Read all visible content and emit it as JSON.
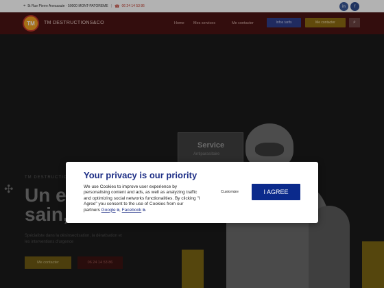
{
  "topbar": {
    "location_icon": "map-pin-icon",
    "address": "5t Rue Pierre Anesasute · 50000 MONT-PATOREME",
    "phone_icon": "phone-icon",
    "phone": "06 24 14 53 86",
    "social": [
      "in",
      "f"
    ]
  },
  "header": {
    "logo": "TM",
    "brand": "TM DESTRUCTIONS&CO",
    "nav": [
      "Home",
      "Mes services",
      "Me contacter"
    ],
    "btn_info": "Infos tarifs",
    "btn_contact": "Me contacter",
    "search_icon": "search-icon"
  },
  "hero": {
    "service_title": "Service",
    "service_sub": "Antiparasitaire",
    "kicker": "TM DESTRUCTIONS",
    "icon": "bug-icon",
    "title_line1": "Un env",
    "title_line2": "sain, s",
    "para1": "Spécialiste dans la désinsectisation, la dératisation et",
    "para2": "les interventions d'urgence",
    "cta_primary": "Me contacter",
    "cta_secondary": "06 24 14 53 86"
  },
  "cookie": {
    "title": "Your privacy is our priority",
    "text": "We use Cookies to improve user experience by personalising content and ads, as well as analyzing traffic and optimizing social networks functionalities. By clicking \"I Agree\" you consent to the use of Cookies from our partners",
    "link_google": "Google",
    "link_facebook": "Facebook",
    "customize": "Customize",
    "agree": "I AGREE"
  }
}
